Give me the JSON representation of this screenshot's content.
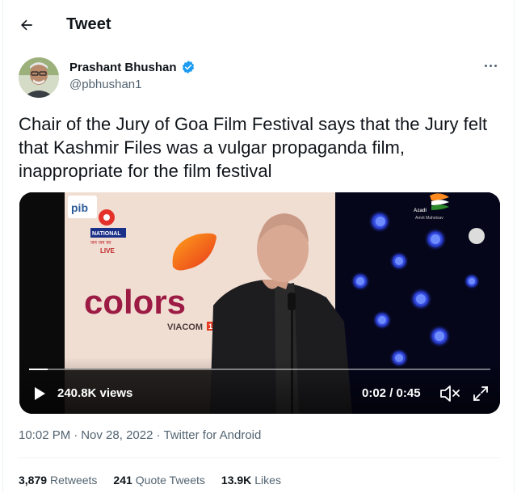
{
  "header": {
    "title": "Tweet",
    "back_icon": "arrow-left-icon"
  },
  "author": {
    "display_name": "Prashant Bhushan",
    "handle": "@pbhushan1",
    "verified": true,
    "badge_color": "#1d9bf0"
  },
  "tweet": {
    "text": "Chair of the Jury of Goa Film Festival says that the Jury felt that Kashmir Files was a vulgar propaganda film, inappropriate for the film festival"
  },
  "media": {
    "views": "240.8K views",
    "time": "0:02 / 0:45",
    "progress": 0.04,
    "overlay": {
      "broadcaster": "pib",
      "channel": "NATIONAL",
      "channel_sub": "जन जन का",
      "live": "LIVE",
      "backdrop_logo": "colors",
      "backdrop_brand": "VIACOM",
      "backdrop_brand_num": "18",
      "event_tag_1": "Azadi",
      "event_tag_2": "Amrit Mahotsav"
    }
  },
  "meta": {
    "time": "10:02 PM",
    "separator": "·",
    "date": "Nov 28, 2022",
    "source": "Twitter for Android"
  },
  "stats": {
    "retweets_count": "3,879",
    "retweets_label": "Retweets",
    "quotes_count": "241",
    "quotes_label": "Quote Tweets",
    "likes_count": "13.9K",
    "likes_label": "Likes"
  }
}
